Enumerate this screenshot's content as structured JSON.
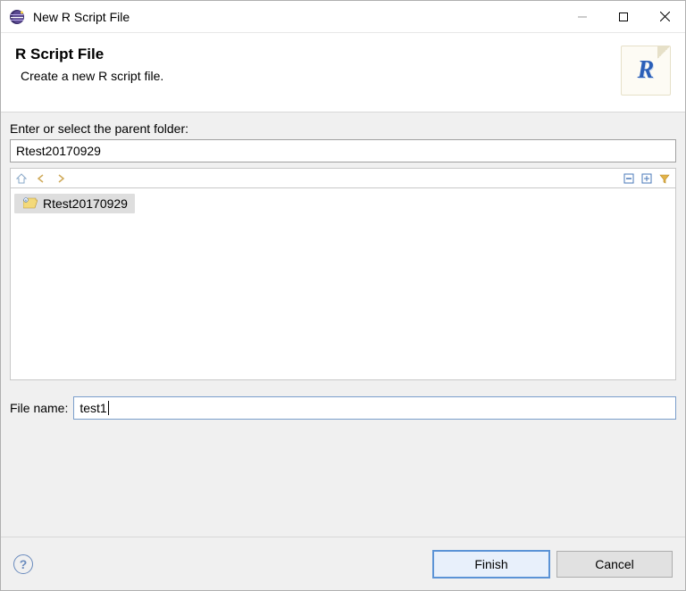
{
  "titlebar": {
    "title": "New R Script File"
  },
  "header": {
    "title": "R Script File",
    "subtitle": "Create a new R script file.",
    "icon_letter": "R"
  },
  "parent_folder": {
    "label": "Enter or select the parent folder:",
    "value": "Rtest20170929"
  },
  "tree": {
    "items": [
      {
        "label": "Rtest20170929",
        "selected": true
      }
    ]
  },
  "filename": {
    "label": "File name:",
    "value": "test1"
  },
  "buttons": {
    "finish": "Finish",
    "cancel": "Cancel"
  },
  "help_tooltip": "?"
}
